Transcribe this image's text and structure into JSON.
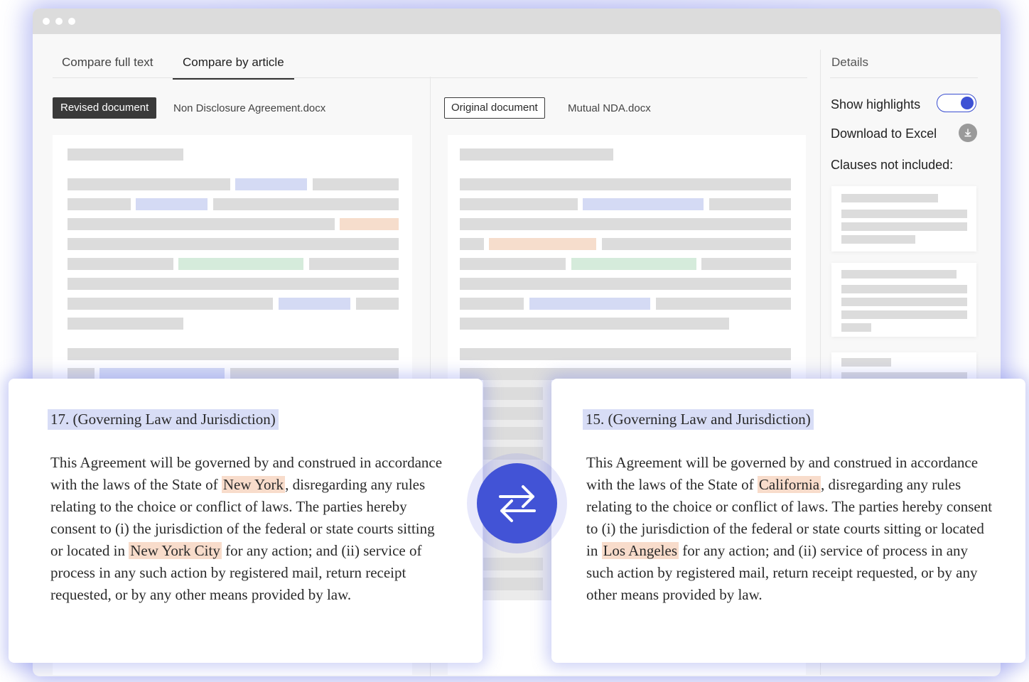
{
  "tabs": [
    {
      "label": "Compare full text",
      "active": false
    },
    {
      "label": "Compare by article",
      "active": true
    }
  ],
  "revised": {
    "badge": "Revised document",
    "filename": "Non Disclosure Agreement.docx"
  },
  "original": {
    "badge": "Original document",
    "filename": "Mutual NDA.docx"
  },
  "details": {
    "title": "Details",
    "show_highlights_label": "Show highlights",
    "show_highlights_on": true,
    "download_label": "Download to Excel",
    "clauses_label": "Clauses not included:"
  },
  "left_clause": {
    "title": "17. (Governing Law and Jurisdiction)",
    "p1": "This Agreement will be governed by and construed in accordance with the laws of the State of",
    "h1": "New York",
    "p2": ", disregarding any rules relating to the choice or conflict of laws. The parties hereby consent to (i) the jurisdiction of the federal or state courts sitting or located in",
    "h2": "New York City",
    "p3": "for any action; and (ii) service of process in any such action by registered mail, return receipt requested, or by any other means provided by law."
  },
  "right_clause": {
    "title": "15. (Governing Law and Jurisdiction)",
    "p1": "This Agreement will be governed by and construed in accordance with the laws of the State of",
    "h1": "California",
    "p2": ", disregarding any rules relating to the choice or conflict of laws. The parties hereby consent to (i) the jurisdiction of the federal or state courts sitting or located in",
    "h2": "Los Angeles",
    "p3": "for any action; and (ii) service of process in any such action by registered mail, return receipt requested, or by any other means provided by law."
  },
  "colors": {
    "accent": "#4253d6",
    "highlight_orange": "#f8dccb",
    "highlight_blue": "#d4daf4",
    "highlight_green": "#d5ebdb"
  },
  "icons": {
    "swap": "swap-arrows-icon",
    "download": "download-icon"
  }
}
